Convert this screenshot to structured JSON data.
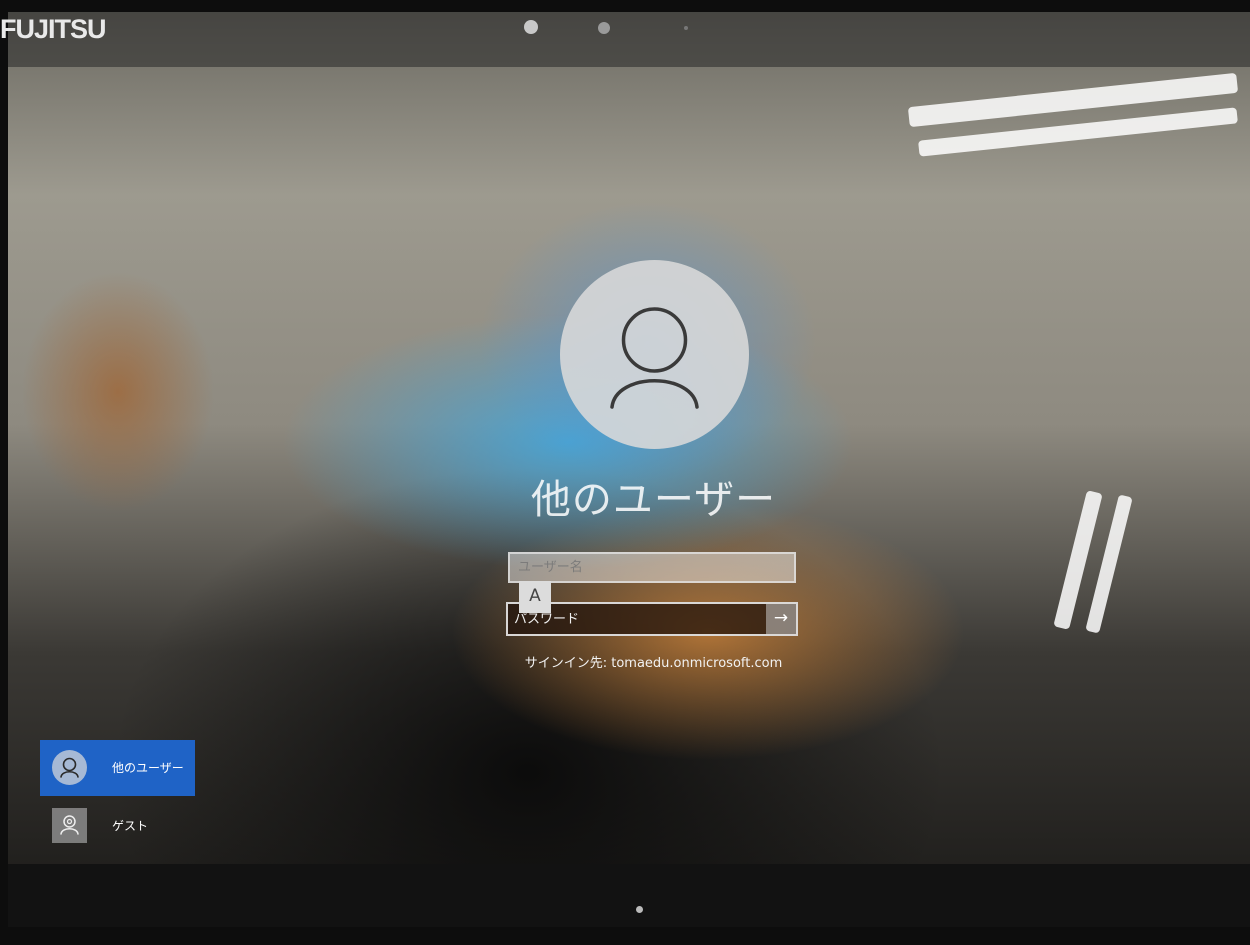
{
  "device": {
    "brand": "FUJITSU"
  },
  "login": {
    "user_title": "他のユーザー",
    "username_placeholder": "ユーザー名",
    "ime_mode": "A",
    "password_placeholder": "パスワード",
    "submit_symbol": "→",
    "sign_in_to": "サインイン先: tomaedu.onmicrosoft.com"
  },
  "accounts": [
    {
      "label": "他のユーザー",
      "icon": "user-icon",
      "selected": true
    },
    {
      "label": "ゲスト",
      "icon": "guest-user-icon",
      "selected": false
    }
  ],
  "colors": {
    "accent": "#1f63c6"
  }
}
